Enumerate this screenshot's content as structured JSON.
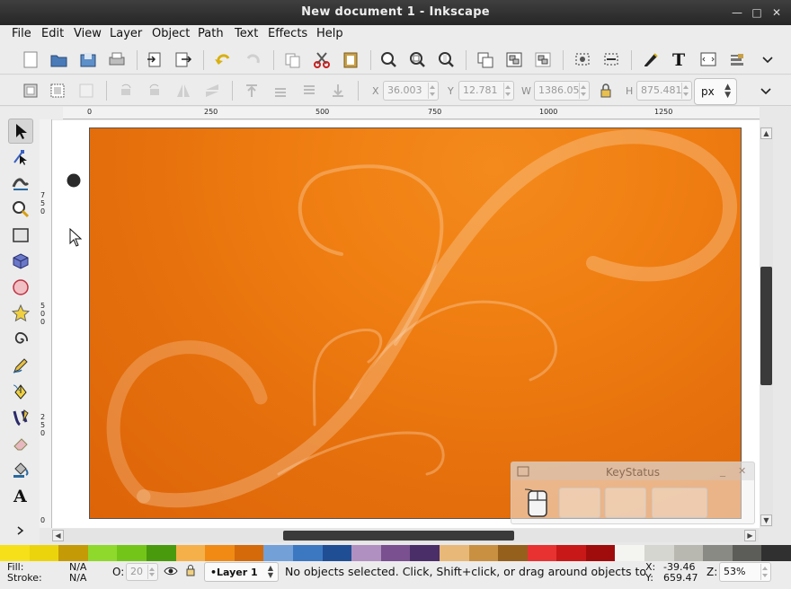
{
  "window": {
    "title": "New document 1 - Inkscape",
    "controls": [
      "minimize-icon",
      "maximize-icon",
      "close-icon"
    ]
  },
  "menu": [
    "File",
    "Edit",
    "View",
    "Layer",
    "Object",
    "Path",
    "Text",
    "Effects",
    "Help"
  ],
  "toolbar_commands": {
    "icons": [
      "new-document-icon",
      "open-icon",
      "save-icon",
      "print-icon",
      "import-icon",
      "export-icon",
      "undo-icon",
      "redo-icon",
      "copy-icon",
      "cut-icon",
      "paste-icon",
      "zoom-selection-icon",
      "zoom-drawing-icon",
      "zoom-page-icon",
      "duplicate-icon",
      "group-icon",
      "ungroup-icon",
      "fill-stroke-icon",
      "align-icon",
      "xml-editor-icon",
      "text-font-icon",
      "transform-icon",
      "layers-icon",
      "overflow-chevron-icon"
    ]
  },
  "selector_toolbar": {
    "x_label": "X",
    "x_value": "36.003",
    "y_label": "Y",
    "y_value": "12.781",
    "w_label": "W",
    "w_value": "1386.05",
    "h_label": "H",
    "h_value": "875.481",
    "unit": "px"
  },
  "rulers": {
    "top_labels": [
      "0",
      "250",
      "500",
      "750",
      "1000",
      "1250"
    ],
    "left_labels": [
      "7\n5\n0",
      "5\n0\n0",
      "2\n5\n0",
      "0"
    ]
  },
  "tools": [
    "selector-tool",
    "node-tool",
    "tweak-tool",
    "zoom-tool",
    "rectangle-tool",
    "3d-box-tool",
    "ellipse-tool",
    "star-tool",
    "spiral-tool",
    "pencil-tool",
    "pen-tool",
    "calligraphy-tool",
    "eraser-tool",
    "paint-bucket-tool",
    "text-tool",
    "more-tools-chevron"
  ],
  "keystatus": {
    "title": "KeyStatus"
  },
  "palette": [
    "#f5e01a",
    "#ecd40c",
    "#c49a06",
    "#8ed92c",
    "#74c51a",
    "#4a9a0e",
    "#f5b04a",
    "#f08a14",
    "#d46a0a",
    "#74a0d8",
    "#3c78c2",
    "#1f4e94",
    "#b090c0",
    "#7a5090",
    "#4a2e68",
    "#e8b878",
    "#c89040",
    "#94601c",
    "#e83232",
    "#c81818",
    "#a00c0c",
    "#f4f4f0",
    "#d6d6d0",
    "#b8b8b0",
    "#8a8a84",
    "#5c5c58",
    "#303030"
  ],
  "status": {
    "fill_label": "Fill:",
    "fill_value": "N/A",
    "stroke_label": "Stroke:",
    "stroke_value": "N/A",
    "opacity_label": "O:",
    "opacity_value": "20",
    "layer": "•Layer 1",
    "message": "No objects selected. Click, Shift+click, or drag around objects to",
    "x_label": "X:",
    "x_value": "-39.46",
    "y_label": "Y:",
    "y_value": "659.47",
    "zoom_label": "Z:",
    "zoom_value": "53%"
  }
}
